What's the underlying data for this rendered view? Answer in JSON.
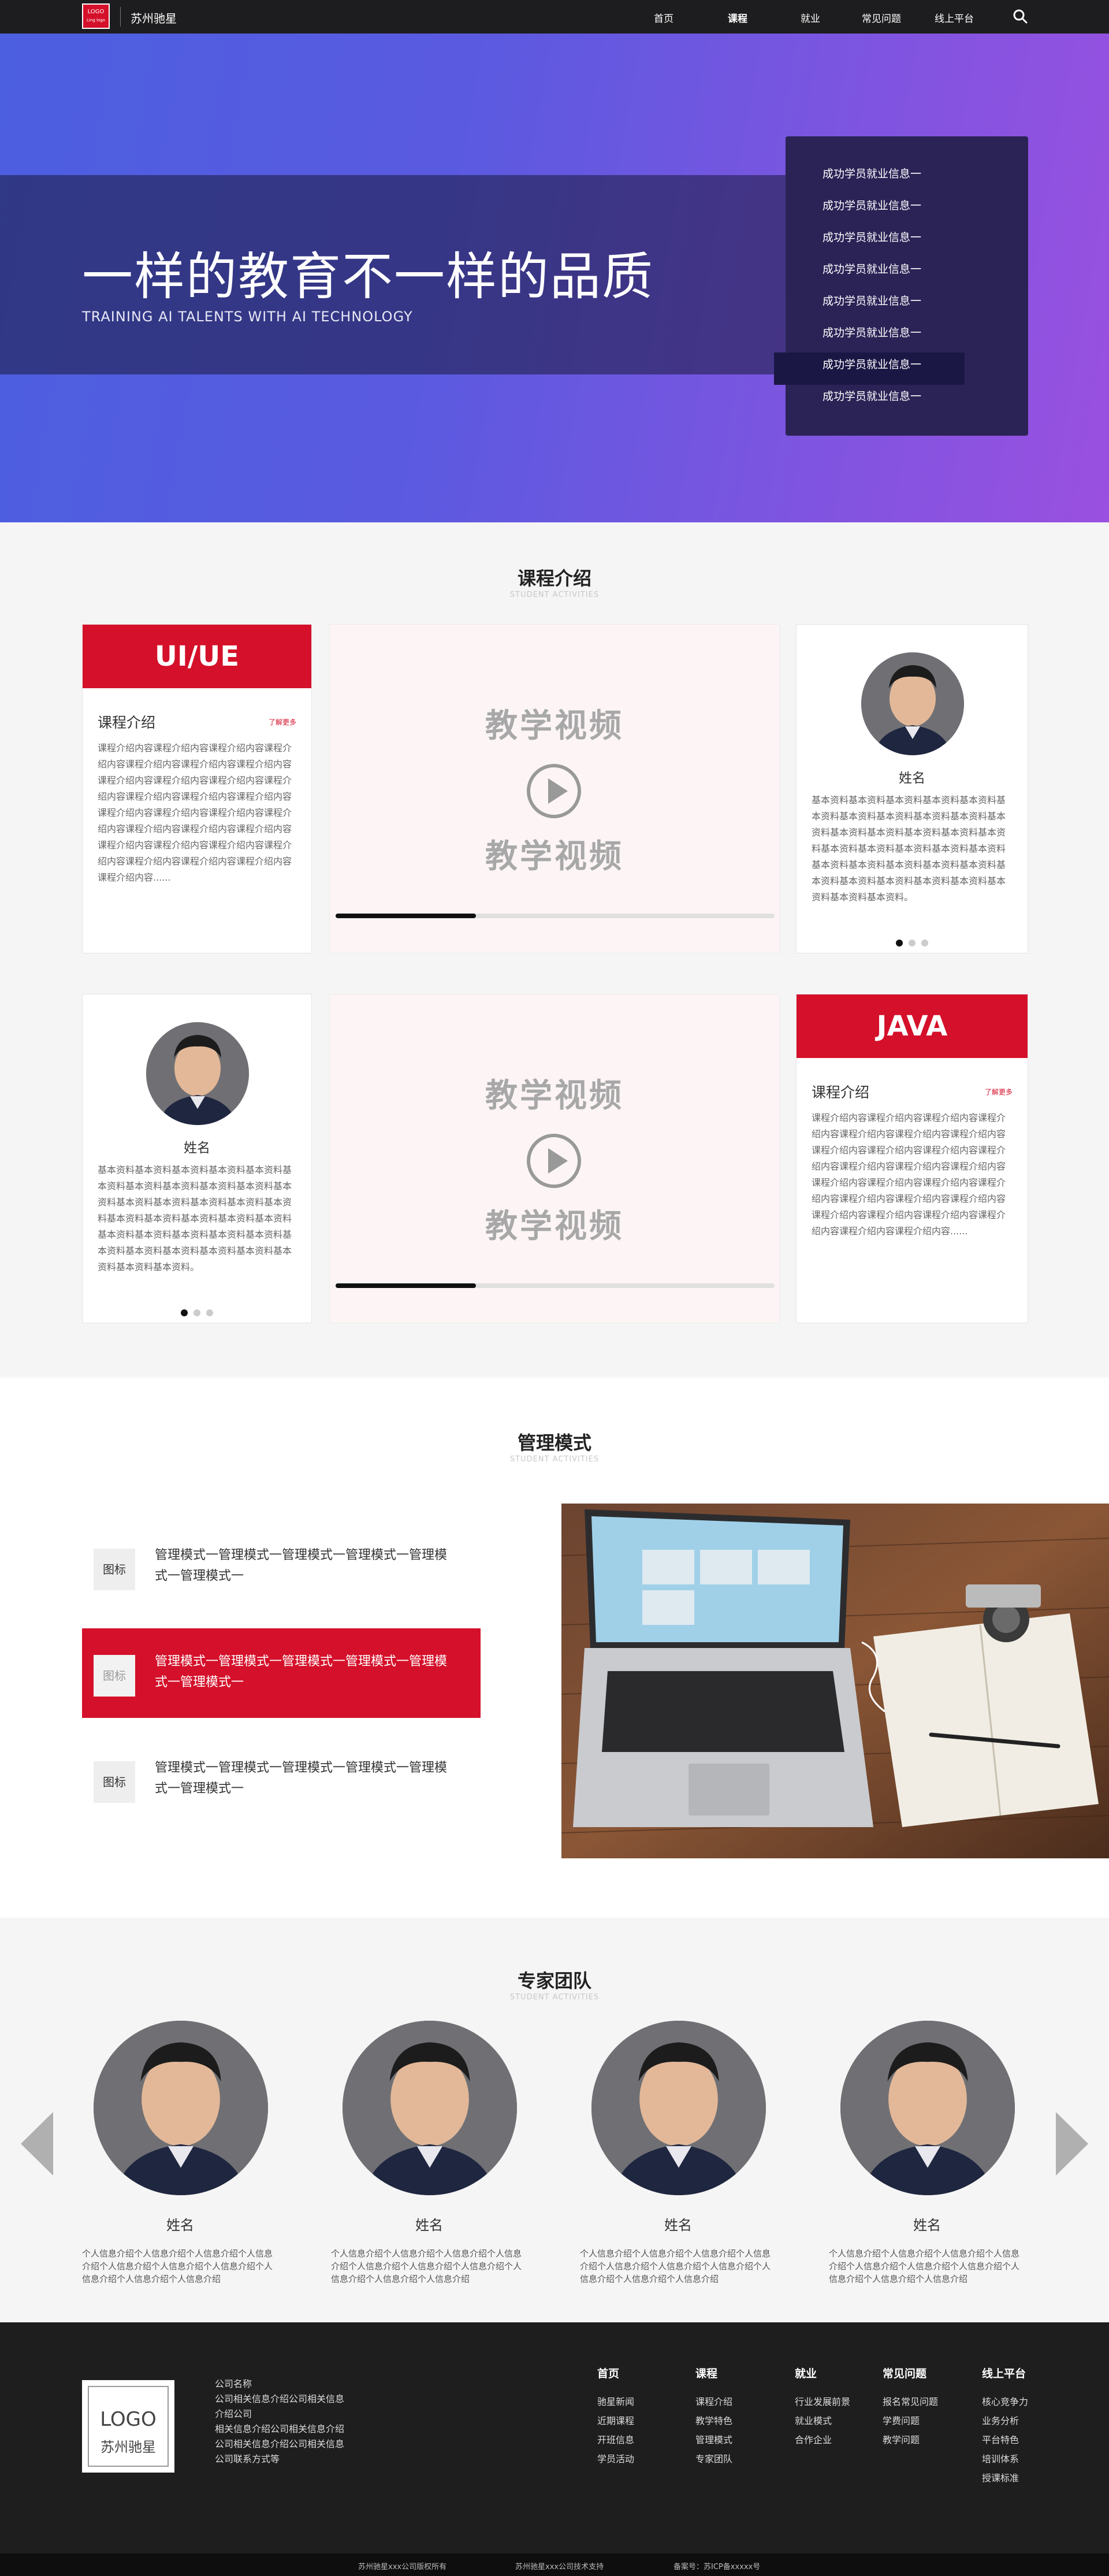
{
  "nav": {
    "logo_line1": "LOGO",
    "logo_line2": "Ling logo",
    "brand": "苏州驰星",
    "items": [
      "首页",
      "课程",
      "就业",
      "常见问题",
      "线上平台"
    ],
    "active_item": "课程",
    "search_icon": "search-icon"
  },
  "hero": {
    "title": "一样的教育不一样的品质",
    "subtitle": "TRAINING AI TALENTS WITH AI TECHNOLOGY",
    "news": [
      "成功学员就业信息一",
      "成功学员就业信息一",
      "成功学员就业信息一",
      "成功学员就业信息一",
      "成功学员就业信息一",
      "成功学员就业信息一",
      "成功学员就业信息一",
      "成功学员就业信息一"
    ],
    "highlighted_index": 5
  },
  "course": {
    "title": "课程介绍",
    "subtitle": "STUDENT ACTIVITIES",
    "card1": {
      "head": "UI/UE",
      "title": "课程介绍",
      "more": "了解更多",
      "text": "课程介绍内容课程介绍内容课程介绍内容课程介绍内容课程介绍内容课程介绍内容课程介绍内容课程介绍内容课程介绍内容课程介绍内容课程介绍内容课程介绍内容课程介绍内容课程介绍内容课程介绍内容课程介绍内容课程介绍内容课程介绍内容课程介绍内容课程介绍内容课程介绍内容课程介绍内容课程介绍内容课程介绍内容课程介绍内容课程介绍内容课程介绍内容课程介绍内容课程介绍内容......"
    },
    "video": {
      "label_top": "教学视频",
      "label_bottom": "教学视频",
      "play_icon": "play-icon",
      "progress": 0.32
    },
    "profile": {
      "name": "姓名",
      "text": "基本资料基本资料基本资料基本资料基本资料基本资料基本资料基本资料基本资料基本资料基本资料基本资料基本资料基本资料基本资料基本资料基本资料基本资料基本资料基本资料基本资料基本资料基本资料基本资料基本资料基本资料基本资料基本资料基本资料基本资料基本资料基本资料基本资料基本资料。",
      "dot_count": 3,
      "active_dot": 0
    },
    "card2": {
      "head": "JAVA",
      "title": "课程介绍",
      "more": "了解更多",
      "text": "课程介绍内容课程介绍内容课程介绍内容课程介绍内容课程介绍内容课程介绍内容课程介绍内容课程介绍内容课程介绍内容课程介绍内容课程介绍内容课程介绍内容课程介绍内容课程介绍内容课程介绍内容课程介绍内容课程介绍内容课程介绍内容课程介绍内容课程介绍内容课程介绍内容课程介绍内容课程介绍内容课程介绍内容课程介绍内容课程介绍内容课程介绍内容......"
    }
  },
  "management": {
    "title": "管理模式",
    "subtitle": "STUDENT ACTIVITIES",
    "items": [
      {
        "icon": "图标",
        "text": "管理模式一管理模式一管理模式一管理模式一管理模式一管理模式一"
      },
      {
        "icon": "图标",
        "text": "管理模式一管理模式一管理模式一管理模式一管理模式一管理模式一"
      },
      {
        "icon": "图标",
        "text": "管理模式一管理模式一管理模式一管理模式一管理模式一管理模式一"
      }
    ],
    "active_index": 1
  },
  "experts": {
    "title": "专家团队",
    "subtitle": "STUDENT ACTIVITIES",
    "members": [
      {
        "name": "姓名",
        "desc": "个人信息介绍个人信息介绍个人信息介绍个人信息介绍个人信息介绍个人信息介绍个人信息介绍个人信息介绍个人信息介绍个人信息介绍"
      },
      {
        "name": "姓名",
        "desc": "个人信息介绍个人信息介绍个人信息介绍个人信息介绍个人信息介绍个人信息介绍个人信息介绍个人信息介绍个人信息介绍个人信息介绍"
      },
      {
        "name": "姓名",
        "desc": "个人信息介绍个人信息介绍个人信息介绍个人信息介绍个人信息介绍个人信息介绍个人信息介绍个人信息介绍个人信息介绍个人信息介绍"
      },
      {
        "name": "姓名",
        "desc": "个人信息介绍个人信息介绍个人信息介绍个人信息介绍个人信息介绍个人信息介绍个人信息介绍个人信息介绍个人信息介绍个人信息介绍"
      }
    ],
    "prev_icon": "arrow-left-icon",
    "next_icon": "arrow-right-icon"
  },
  "footer": {
    "logo_line1": "LOGO",
    "logo_line2": "苏州驰星",
    "info": [
      "公司名称",
      "公司相关信息介绍公司相关信息介绍公司",
      "相关信息介绍公司相关信息介绍公司相关信息介绍公司相关信息",
      "公司联系方式等"
    ],
    "columns": [
      {
        "title": "首页",
        "items": [
          "驰星新闻",
          "近期课程",
          "开班信息",
          "学员活动"
        ]
      },
      {
        "title": "课程",
        "items": [
          "课程介绍",
          "教学特色",
          "管理模式",
          "专家团队"
        ]
      },
      {
        "title": "就业",
        "items": [
          "行业发展前景",
          "就业模式",
          "合作企业"
        ]
      },
      {
        "title": "常见问题",
        "items": [
          "报名常见问题",
          "学费问题",
          "教学问题"
        ]
      },
      {
        "title": "线上平台",
        "items": [
          "核心竞争力",
          "业务分析",
          "平台特色",
          "培训体系",
          "授课标准"
        ]
      }
    ],
    "copyright": [
      "苏州驰星xxx公司版权所有",
      "苏州驰星xxx公司技术支持",
      "备案号：苏ICP备xxxxx号"
    ]
  },
  "colors": {
    "accent": "#d5102a",
    "nav_bg": "#1d1d1f",
    "footer_bg": "#1e1e1e",
    "hero_gradient_start": "#4c5fe0",
    "hero_gradient_end": "#9a50e0"
  }
}
